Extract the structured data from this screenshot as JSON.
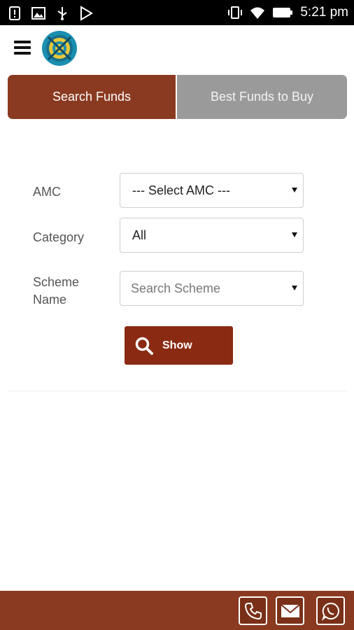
{
  "status_bar": {
    "time": "5:21 pm"
  },
  "header": {
    "logo_name": "app-logo"
  },
  "tabs": [
    {
      "label": "Search Funds",
      "active": true
    },
    {
      "label": "Best Funds to Buy",
      "active": false
    }
  ],
  "form": {
    "amc": {
      "label": "AMC",
      "value": "--- Select AMC ---"
    },
    "category": {
      "label": "Category",
      "value": "All"
    },
    "scheme": {
      "label_line1": "Scheme",
      "label_line2": "Name",
      "placeholder": "Search Scheme"
    },
    "show_label": "Show"
  },
  "footer": {
    "icons": [
      "phone-icon",
      "mail-icon",
      "whatsapp-icon"
    ]
  },
  "colors": {
    "brand": "#8a3a20",
    "button": "#8a2a12",
    "inactive_tab": "#9a9a9a",
    "status_bar": "#000000"
  }
}
